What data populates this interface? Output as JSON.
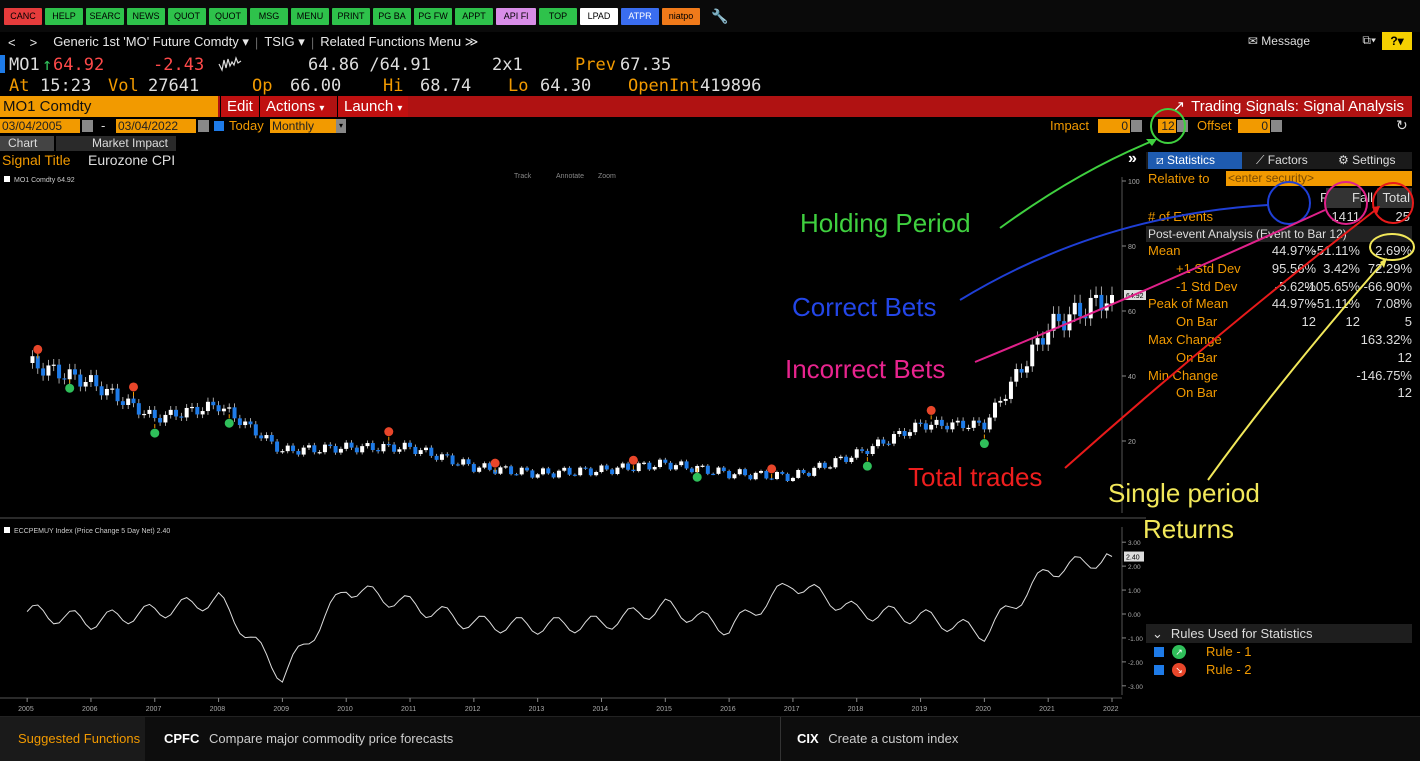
{
  "launchpad": {
    "buttons": [
      {
        "label": "CANC",
        "color": "#e63c3c"
      },
      {
        "label": "HELP",
        "color": "#2ec24b"
      },
      {
        "label": "SEARC",
        "color": "#2ec24b"
      },
      {
        "label": "NEWS",
        "color": "#2ec24b"
      },
      {
        "label": "QUOT",
        "color": "#2ec24b"
      },
      {
        "label": "QUOT",
        "color": "#2ec24b"
      },
      {
        "label": "MSG",
        "color": "#2ec24b"
      },
      {
        "label": "MENU",
        "color": "#2ec24b"
      },
      {
        "label": "PRINT",
        "color": "#2ec24b"
      },
      {
        "label": "PG BA",
        "color": "#2ec24b"
      },
      {
        "label": "PG FW",
        "color": "#2ec24b"
      },
      {
        "label": "APPT",
        "color": "#2ec24b"
      },
      {
        "label": "API Fl",
        "color": "#d98ee8"
      },
      {
        "label": "TOP",
        "color": "#2ec24b"
      },
      {
        "label": "LPAD",
        "color": "#ffffff"
      },
      {
        "label": "ATPR",
        "color": "#3a6df0"
      },
      {
        "label": "niatpo",
        "color": "#f07a1a"
      }
    ],
    "wrench_icon": "wrench-icon"
  },
  "nav": {
    "back": "<",
    "fwd": ">",
    "security": "Generic 1st 'MO' Future Comdty",
    "function": "TSIG",
    "related": "Related Functions Menu",
    "message": "Message",
    "help": "?"
  },
  "quote": {
    "ticker": "MO1",
    "last": "64.92",
    "change": "-2.43",
    "bid_ask": "64.86 /64.91",
    "size": "2x1",
    "prev_label": "Prev",
    "prev": "67.35",
    "at_label": "At",
    "time": "15:23",
    "vol_label": "Vol",
    "vol": "27641",
    "op_label": "Op",
    "op": "66.00",
    "hi_label": "Hi",
    "hi": "68.74",
    "lo_label": "Lo",
    "lo": "64.30",
    "oi_label": "OpenInt",
    "oi": "419896"
  },
  "toolbar": {
    "ticker": "MO1 Comdty",
    "edit": "Edit",
    "actions": "Actions",
    "launch": "Launch",
    "title": "Trading Signals: Signal Analysis"
  },
  "dates": {
    "start": "03/04/2005",
    "end": "03/04/2022",
    "today": "Today",
    "freq": "Monthly",
    "impact_label": "Impact",
    "impact": "0",
    "holding": "12",
    "offset_label": "Offset",
    "offset": "0"
  },
  "tabs": {
    "chart": "Chart",
    "impact": "Market Impact"
  },
  "signal": {
    "label": "Signal Title",
    "value": "Eurozone CPI"
  },
  "chart_toolbar": {
    "track": "Track",
    "annotate": "Annotate",
    "zoom": "Zoom"
  },
  "upper_legend": "MO1 Comdty 64.92",
  "lower_legend": "ECCPEMUY Index (Price Change 5 Day Net) 2.40",
  "colors": {
    "up": "#ffffff",
    "down": "#1e7be8",
    "rise": "#2fbf5a",
    "fall": "#e8462a",
    "accent": "#f29a00"
  },
  "chart_data": [
    {
      "type": "candlestick",
      "name": "MO1 Comdty",
      "x": [
        "2005",
        "2006",
        "2007",
        "2008",
        "2009",
        "2010",
        "2011",
        "2012",
        "2013",
        "2014",
        "2015",
        "2016",
        "2017",
        "2018",
        "2019",
        "2020",
        "2021",
        "2022"
      ],
      "close_yearly": [
        44,
        38,
        27,
        31,
        17,
        18,
        18,
        12,
        10,
        11,
        13,
        10,
        9,
        16,
        25,
        25,
        55,
        64.92
      ],
      "ylim": [
        0,
        100
      ],
      "yticks": [
        "100",
        "80",
        "60",
        "40",
        "20"
      ],
      "last_label": "64.92"
    },
    {
      "type": "line",
      "name": "ECCPEMUY Index",
      "x": [
        "2005",
        "2006",
        "2007",
        "2008",
        "2009",
        "2010",
        "2011",
        "2012",
        "2013",
        "2014",
        "2015",
        "2016",
        "2017",
        "2018",
        "2019",
        "2020",
        "2021",
        "2022"
      ],
      "values": [
        0.1,
        -0.3,
        0.1,
        0.6,
        -2.6,
        1.1,
        0.4,
        -0.4,
        -0.5,
        -0.4,
        0.3,
        -0.6,
        1.3,
        0.1,
        -0.1,
        -0.8,
        1.8,
        2.4
      ],
      "ylim": [
        -3.3,
        3.3
      ],
      "yticks": [
        "3.00",
        "2.00",
        "1.00",
        "0.00",
        "-1.00",
        "-2.00",
        "-3.00"
      ],
      "last_label": "2.40"
    }
  ],
  "panel": {
    "tabs": [
      "Statistics",
      "Factors",
      "Settings"
    ],
    "relative_label": "Relative to",
    "relative_placeholder": "<enter security>",
    "cols": [
      "Rise",
      "Fall",
      "Total"
    ],
    "events_label": "# of Events",
    "events": [
      "14",
      "11",
      "25"
    ],
    "post_label": "Post-event Analysis (Event to Bar 12)",
    "rows": [
      {
        "label": "Mean",
        "v": [
          "44.97%",
          "-51.11%",
          "2.69%"
        ]
      },
      {
        "label": "+1 Std Dev",
        "v": [
          "95.56%",
          "3.42%",
          "72.29%"
        ]
      },
      {
        "label": "-1 Std Dev",
        "v": [
          "-5.62%",
          "-105.65%",
          "-66.90%"
        ]
      },
      {
        "label": "Peak of Mean",
        "v": [
          "44.97%",
          "-51.11%",
          "7.08%"
        ]
      },
      {
        "label": "On Bar",
        "v": [
          "12",
          "12",
          "5"
        ]
      },
      {
        "label": "Max Change",
        "v": [
          "",
          "",
          "163.32%"
        ]
      },
      {
        "label": "On Bar",
        "v": [
          "",
          "",
          "12"
        ]
      },
      {
        "label": "Min Change",
        "v": [
          "",
          "",
          "-146.75%"
        ]
      },
      {
        "label": "On Bar",
        "v": [
          "",
          "",
          "12"
        ]
      }
    ],
    "rules_title": "Rules Used for Statistics",
    "rules": [
      "Rule - 1",
      "Rule - 2"
    ]
  },
  "annotations": {
    "holding": "Holding Period",
    "correct": "Correct Bets",
    "incorrect": "Incorrect Bets",
    "total": "Total trades",
    "single1": "Single period",
    "single2": "Returns"
  },
  "bottom": {
    "suggested": "Suggested Functions",
    "f1_code": "CPFC",
    "f1_desc": "Compare major commodity price forecasts",
    "f2_code": "CIX",
    "f2_desc": "Create a custom index"
  }
}
